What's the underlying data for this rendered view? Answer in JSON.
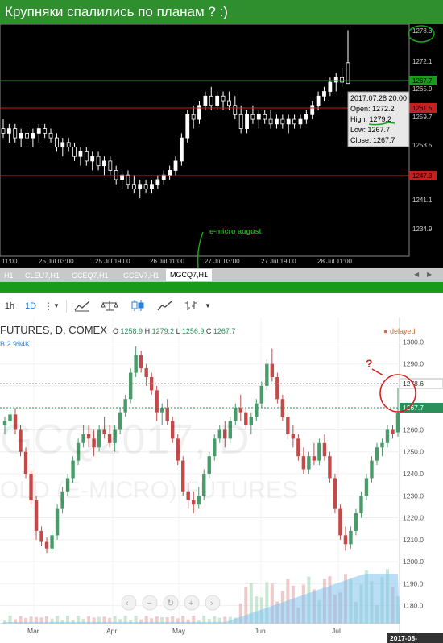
{
  "title": "Крупняки спалились по планам ? :)",
  "mt": {
    "price_labels": [
      "1278.3",
      "1272.1",
      "1265.9",
      "1259.7",
      "1253.5",
      "1247.3",
      "1241.1",
      "1234.9"
    ],
    "time_labels": [
      "11:00",
      "25 Jul 03:00",
      "25 Jul 19:00",
      "26 Jul 11:00",
      "27 Jul 03:00",
      "27 Jul 19:00",
      "28 Jul 11:00"
    ],
    "green_price": "1267.7",
    "red_price_1": "1261.5",
    "red_price_2": "1247.3",
    "tooltip": {
      "date": "2017.07.28 20:00",
      "open": "Open: 1272.2",
      "high": "High: 1279.2",
      "low": "Low: 1267.7",
      "close": "Close: 1267.7"
    },
    "annotation": "e-micro august",
    "tabs": [
      "H1",
      "CLEU7,H1",
      "GCEQ7,H1",
      "GCEV7,H1",
      "MGCQ7,H1"
    ],
    "active_tab": "MGCQ7,H1"
  },
  "toolbar": {
    "interval_1": "1h",
    "interval_2": "1D"
  },
  "tv": {
    "header": "FUTURES, D, COMEX",
    "ohlc_o_label": "O",
    "ohlc_o": "1258.9",
    "ohlc_h_label": "H",
    "ohlc_h": "1279.2",
    "ohlc_l_label": "L",
    "ohlc_l": "1256.9",
    "ohlc_c_label": "C",
    "ohlc_c": "1267.7",
    "volume": "B  2.994K",
    "delayed": "delayed",
    "watermark_symbol": "GCQ2017, D",
    "watermark_desc": "OLD (E-MICRO) FUTURES",
    "price_labels": [
      "1300.0",
      "1290.0",
      "1280.0",
      "1270.0",
      "1260.0",
      "1250.0",
      "1240.0",
      "1230.0",
      "1220.0",
      "1210.0",
      "1200.0",
      "1190.0",
      "1180.0"
    ],
    "high_tag": "1278.6",
    "last_tag": "1267.7",
    "months": [
      "Mar",
      "Apr",
      "May",
      "Jun",
      "Jul"
    ],
    "date_tag": "2017-08-",
    "question": "?"
  },
  "colors": {
    "up": "#4a9a6a",
    "down": "#c44a4a",
    "mt_bull": "#ffffff",
    "mt_bear": "#000000"
  },
  "mt_candles": [
    {
      "o": 1258,
      "h": 1260,
      "l": 1256,
      "c": 1257
    },
    {
      "o": 1257,
      "h": 1259,
      "l": 1255,
      "c": 1258
    },
    {
      "o": 1258,
      "h": 1259,
      "l": 1255,
      "c": 1256
    },
    {
      "o": 1256,
      "h": 1258,
      "l": 1254,
      "c": 1257
    },
    {
      "o": 1257,
      "h": 1258,
      "l": 1255,
      "c": 1256
    },
    {
      "o": 1256,
      "h": 1258,
      "l": 1254,
      "c": 1257
    },
    {
      "o": 1257,
      "h": 1259,
      "l": 1255,
      "c": 1258
    },
    {
      "o": 1258,
      "h": 1259,
      "l": 1256,
      "c": 1257
    },
    {
      "o": 1257,
      "h": 1258,
      "l": 1255,
      "c": 1256
    },
    {
      "o": 1256,
      "h": 1257,
      "l": 1253,
      "c": 1254
    },
    {
      "o": 1254,
      "h": 1256,
      "l": 1252,
      "c": 1255
    },
    {
      "o": 1255,
      "h": 1256,
      "l": 1253,
      "c": 1254
    },
    {
      "o": 1254,
      "h": 1255,
      "l": 1251,
      "c": 1252
    },
    {
      "o": 1252,
      "h": 1254,
      "l": 1250,
      "c": 1253
    },
    {
      "o": 1253,
      "h": 1254,
      "l": 1250,
      "c": 1251
    },
    {
      "o": 1251,
      "h": 1253,
      "l": 1249,
      "c": 1252
    },
    {
      "o": 1252,
      "h": 1253,
      "l": 1249,
      "c": 1250
    },
    {
      "o": 1250,
      "h": 1252,
      "l": 1248,
      "c": 1251
    },
    {
      "o": 1251,
      "h": 1252,
      "l": 1248,
      "c": 1249
    },
    {
      "o": 1249,
      "h": 1250,
      "l": 1246,
      "c": 1247
    },
    {
      "o": 1247,
      "h": 1249,
      "l": 1245,
      "c": 1248
    },
    {
      "o": 1248,
      "h": 1249,
      "l": 1245,
      "c": 1246
    },
    {
      "o": 1246,
      "h": 1248,
      "l": 1244,
      "c": 1245
    },
    {
      "o": 1245,
      "h": 1247,
      "l": 1243,
      "c": 1246
    },
    {
      "o": 1246,
      "h": 1247,
      "l": 1244,
      "c": 1245
    },
    {
      "o": 1245,
      "h": 1247,
      "l": 1244,
      "c": 1246
    },
    {
      "o": 1246,
      "h": 1248,
      "l": 1245,
      "c": 1247
    },
    {
      "o": 1247,
      "h": 1249,
      "l": 1246,
      "c": 1248
    },
    {
      "o": 1248,
      "h": 1250,
      "l": 1247,
      "c": 1249
    },
    {
      "o": 1249,
      "h": 1252,
      "l": 1248,
      "c": 1251
    },
    {
      "o": 1251,
      "h": 1257,
      "l": 1250,
      "c": 1256
    },
    {
      "o": 1256,
      "h": 1262,
      "l": 1255,
      "c": 1261
    },
    {
      "o": 1261,
      "h": 1263,
      "l": 1258,
      "c": 1260
    },
    {
      "o": 1260,
      "h": 1264,
      "l": 1259,
      "c": 1263
    },
    {
      "o": 1263,
      "h": 1266,
      "l": 1262,
      "c": 1265
    },
    {
      "o": 1265,
      "h": 1267,
      "l": 1262,
      "c": 1263
    },
    {
      "o": 1263,
      "h": 1266,
      "l": 1262,
      "c": 1265
    },
    {
      "o": 1265,
      "h": 1266,
      "l": 1262,
      "c": 1264
    },
    {
      "o": 1264,
      "h": 1266,
      "l": 1262,
      "c": 1263
    },
    {
      "o": 1263,
      "h": 1265,
      "l": 1260,
      "c": 1261
    },
    {
      "o": 1261,
      "h": 1263,
      "l": 1257,
      "c": 1258
    },
    {
      "o": 1258,
      "h": 1262,
      "l": 1257,
      "c": 1261
    },
    {
      "o": 1261,
      "h": 1263,
      "l": 1259,
      "c": 1260
    },
    {
      "o": 1260,
      "h": 1262,
      "l": 1258,
      "c": 1261
    },
    {
      "o": 1261,
      "h": 1262,
      "l": 1259,
      "c": 1260
    },
    {
      "o": 1260,
      "h": 1262,
      "l": 1258,
      "c": 1259
    },
    {
      "o": 1259,
      "h": 1261,
      "l": 1258,
      "c": 1260
    },
    {
      "o": 1260,
      "h": 1261,
      "l": 1258,
      "c": 1259
    },
    {
      "o": 1259,
      "h": 1261,
      "l": 1257,
      "c": 1260
    },
    {
      "o": 1260,
      "h": 1261,
      "l": 1258,
      "c": 1259
    },
    {
      "o": 1259,
      "h": 1261,
      "l": 1258,
      "c": 1260
    },
    {
      "o": 1260,
      "h": 1262,
      "l": 1259,
      "c": 1261
    },
    {
      "o": 1261,
      "h": 1264,
      "l": 1260,
      "c": 1263
    },
    {
      "o": 1263,
      "h": 1266,
      "l": 1262,
      "c": 1265
    },
    {
      "o": 1265,
      "h": 1267,
      "l": 1264,
      "c": 1266
    },
    {
      "o": 1266,
      "h": 1269,
      "l": 1265,
      "c": 1268
    },
    {
      "o": 1268,
      "h": 1270,
      "l": 1266,
      "c": 1269
    },
    {
      "o": 1269,
      "h": 1271,
      "l": 1267,
      "c": 1268
    },
    {
      "o": 1272.2,
      "h": 1279.2,
      "l": 1267.7,
      "c": 1267.7
    }
  ],
  "tv_candles": [
    {
      "o": 1262,
      "h": 1266,
      "l": 1258,
      "c": 1264
    },
    {
      "o": 1264,
      "h": 1269,
      "l": 1260,
      "c": 1267
    },
    {
      "o": 1267,
      "h": 1270,
      "l": 1258,
      "c": 1260
    },
    {
      "o": 1260,
      "h": 1262,
      "l": 1248,
      "c": 1250
    },
    {
      "o": 1250,
      "h": 1252,
      "l": 1238,
      "c": 1240
    },
    {
      "o": 1240,
      "h": 1242,
      "l": 1226,
      "c": 1228
    },
    {
      "o": 1228,
      "h": 1230,
      "l": 1210,
      "c": 1214
    },
    {
      "o": 1214,
      "h": 1216,
      "l": 1207,
      "c": 1209
    },
    {
      "o": 1209,
      "h": 1211,
      "l": 1204,
      "c": 1206
    },
    {
      "o": 1206,
      "h": 1214,
      "l": 1205,
      "c": 1212
    },
    {
      "o": 1212,
      "h": 1226,
      "l": 1210,
      "c": 1224
    },
    {
      "o": 1224,
      "h": 1234,
      "l": 1222,
      "c": 1232
    },
    {
      "o": 1232,
      "h": 1240,
      "l": 1230,
      "c": 1238
    },
    {
      "o": 1238,
      "h": 1248,
      "l": 1236,
      "c": 1246
    },
    {
      "o": 1246,
      "h": 1256,
      "l": 1244,
      "c": 1254
    },
    {
      "o": 1254,
      "h": 1262,
      "l": 1252,
      "c": 1258
    },
    {
      "o": 1258,
      "h": 1262,
      "l": 1252,
      "c": 1256
    },
    {
      "o": 1256,
      "h": 1260,
      "l": 1248,
      "c": 1252
    },
    {
      "o": 1252,
      "h": 1262,
      "l": 1250,
      "c": 1260
    },
    {
      "o": 1260,
      "h": 1266,
      "l": 1256,
      "c": 1258
    },
    {
      "o": 1258,
      "h": 1262,
      "l": 1252,
      "c": 1254
    },
    {
      "o": 1254,
      "h": 1262,
      "l": 1250,
      "c": 1260
    },
    {
      "o": 1260,
      "h": 1270,
      "l": 1258,
      "c": 1268
    },
    {
      "o": 1268,
      "h": 1276,
      "l": 1266,
      "c": 1274
    },
    {
      "o": 1274,
      "h": 1288,
      "l": 1272,
      "c": 1286
    },
    {
      "o": 1286,
      "h": 1298,
      "l": 1284,
      "c": 1294
    },
    {
      "o": 1294,
      "h": 1296,
      "l": 1286,
      "c": 1288
    },
    {
      "o": 1288,
      "h": 1290,
      "l": 1280,
      "c": 1284
    },
    {
      "o": 1284,
      "h": 1286,
      "l": 1276,
      "c": 1278
    },
    {
      "o": 1278,
      "h": 1280,
      "l": 1264,
      "c": 1268
    },
    {
      "o": 1268,
      "h": 1272,
      "l": 1262,
      "c": 1270
    },
    {
      "o": 1270,
      "h": 1274,
      "l": 1262,
      "c": 1264
    },
    {
      "o": 1264,
      "h": 1266,
      "l": 1254,
      "c": 1256
    },
    {
      "o": 1256,
      "h": 1258,
      "l": 1244,
      "c": 1246
    },
    {
      "o": 1246,
      "h": 1248,
      "l": 1230,
      "c": 1232
    },
    {
      "o": 1232,
      "h": 1236,
      "l": 1224,
      "c": 1228
    },
    {
      "o": 1228,
      "h": 1232,
      "l": 1222,
      "c": 1226
    },
    {
      "o": 1226,
      "h": 1234,
      "l": 1224,
      "c": 1230
    },
    {
      "o": 1230,
      "h": 1242,
      "l": 1228,
      "c": 1240
    },
    {
      "o": 1240,
      "h": 1250,
      "l": 1238,
      "c": 1248
    },
    {
      "o": 1248,
      "h": 1258,
      "l": 1246,
      "c": 1256
    },
    {
      "o": 1256,
      "h": 1262,
      "l": 1254,
      "c": 1260
    },
    {
      "o": 1260,
      "h": 1264,
      "l": 1252,
      "c": 1256
    },
    {
      "o": 1256,
      "h": 1266,
      "l": 1254,
      "c": 1264
    },
    {
      "o": 1264,
      "h": 1272,
      "l": 1262,
      "c": 1270
    },
    {
      "o": 1270,
      "h": 1276,
      "l": 1264,
      "c": 1268
    },
    {
      "o": 1268,
      "h": 1270,
      "l": 1260,
      "c": 1262
    },
    {
      "o": 1262,
      "h": 1268,
      "l": 1258,
      "c": 1266
    },
    {
      "o": 1266,
      "h": 1274,
      "l": 1264,
      "c": 1272
    },
    {
      "o": 1272,
      "h": 1282,
      "l": 1270,
      "c": 1280
    },
    {
      "o": 1280,
      "h": 1292,
      "l": 1278,
      "c": 1290
    },
    {
      "o": 1290,
      "h": 1297,
      "l": 1282,
      "c": 1284
    },
    {
      "o": 1284,
      "h": 1286,
      "l": 1272,
      "c": 1274
    },
    {
      "o": 1274,
      "h": 1276,
      "l": 1264,
      "c": 1266
    },
    {
      "o": 1266,
      "h": 1268,
      "l": 1256,
      "c": 1258
    },
    {
      "o": 1258,
      "h": 1262,
      "l": 1252,
      "c": 1256
    },
    {
      "o": 1256,
      "h": 1258,
      "l": 1246,
      "c": 1248
    },
    {
      "o": 1248,
      "h": 1252,
      "l": 1240,
      "c": 1242
    },
    {
      "o": 1242,
      "h": 1250,
      "l": 1240,
      "c": 1248
    },
    {
      "o": 1248,
      "h": 1254,
      "l": 1244,
      "c": 1246
    },
    {
      "o": 1246,
      "h": 1256,
      "l": 1244,
      "c": 1254
    },
    {
      "o": 1254,
      "h": 1258,
      "l": 1246,
      "c": 1248
    },
    {
      "o": 1248,
      "h": 1250,
      "l": 1236,
      "c": 1238
    },
    {
      "o": 1238,
      "h": 1240,
      "l": 1222,
      "c": 1224
    },
    {
      "o": 1224,
      "h": 1226,
      "l": 1210,
      "c": 1212
    },
    {
      "o": 1212,
      "h": 1216,
      "l": 1205,
      "c": 1208
    },
    {
      "o": 1208,
      "h": 1216,
      "l": 1206,
      "c": 1214
    },
    {
      "o": 1214,
      "h": 1224,
      "l": 1212,
      "c": 1222
    },
    {
      "o": 1222,
      "h": 1232,
      "l": 1220,
      "c": 1230
    },
    {
      "o": 1230,
      "h": 1240,
      "l": 1228,
      "c": 1238
    },
    {
      "o": 1238,
      "h": 1248,
      "l": 1236,
      "c": 1246
    },
    {
      "o": 1246,
      "h": 1254,
      "l": 1244,
      "c": 1252
    },
    {
      "o": 1252,
      "h": 1256,
      "l": 1248,
      "c": 1254
    },
    {
      "o": 1254,
      "h": 1262,
      "l": 1252,
      "c": 1260
    },
    {
      "o": 1260,
      "h": 1262,
      "l": 1256,
      "c": 1258
    },
    {
      "o": 1258.9,
      "h": 1279.2,
      "l": 1256.9,
      "c": 1267.7
    }
  ]
}
